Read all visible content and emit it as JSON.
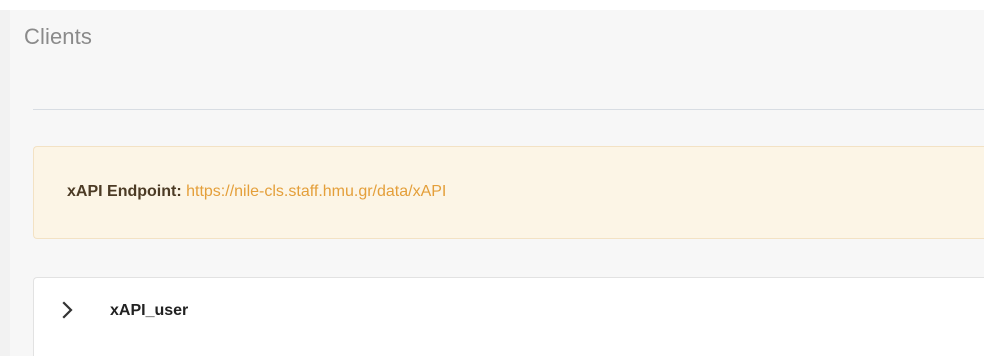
{
  "header": {
    "title": "Clients"
  },
  "alert": {
    "label": "xAPI Endpoint:",
    "url": "https://nile-cls.staff.hmu.gr/data/xAPI"
  },
  "clients": [
    {
      "name": "xAPI_user",
      "icon": "chevron-right-icon"
    }
  ],
  "colors": {
    "alert_background": "#fcf5e6",
    "alert_url": "#e49f3a",
    "title_text": "#8a8a8a"
  }
}
